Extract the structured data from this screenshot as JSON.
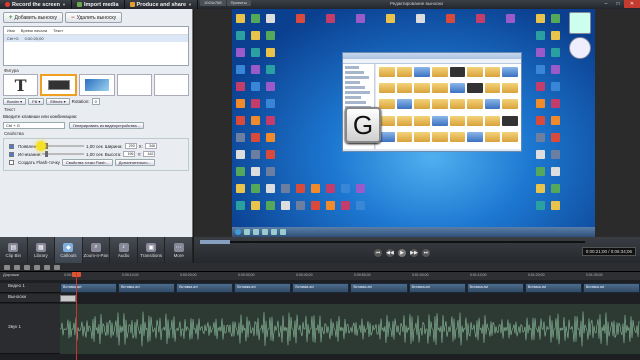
{
  "topbar": {
    "record_label": "Record the screen",
    "import_label": "Import media",
    "produce_label": "Produce and share",
    "canvas_tabs": [
      "1024x768",
      "Проекты"
    ],
    "window_title": "Редактирование выноски",
    "win_controls": [
      "–",
      "□",
      "✕"
    ]
  },
  "left_panel": {
    "add_label": "Добавить выноску",
    "remove_label": "Удалить выноску",
    "list_headers": [
      "Имя",
      "Время начала",
      "Текст"
    ],
    "list_row": [
      "Ctrl+G",
      "0:00:20;00",
      ""
    ],
    "shape_section": "Фигура",
    "border_label": "Border",
    "fill_label": "Fill",
    "effects_label": "Effects",
    "rotation_label": "Rotation:",
    "rotation_value": "0",
    "text_section": "Текст",
    "hotkey_prompt": "Введите клавиши или комбинацию:",
    "hotkey_value": "Ctrl + G",
    "generate_label": "Генерировать из видеоустройства...",
    "props_section": "Свойства",
    "fade_in_label": "Появление:",
    "fade_out_label": "Исчезание:",
    "fade_in_time": "1,00 сек",
    "fade_out_time": "1,00 сек",
    "width_label": "Ширина:",
    "height_label": "Высота:",
    "width_value": "293",
    "height_value": "196",
    "x_label": "X:",
    "y_label": "Y:",
    "x_value": "346",
    "y_value": "442",
    "flash_label": "Создать Flash-точку",
    "flash_points_label": "Свойства точки Flash...",
    "help_label": "Дополнительно..."
  },
  "tools": [
    {
      "label": "Clip Bin",
      "icon": "clip-bin-icon"
    },
    {
      "label": "Library",
      "icon": "library-icon"
    },
    {
      "label": "Callouts",
      "icon": "callouts-icon"
    },
    {
      "label": "Zoom-n-Pan",
      "icon": "zoom-icon"
    },
    {
      "label": "Audio",
      "icon": "audio-icon"
    },
    {
      "label": "Transitions",
      "icon": "transitions-icon"
    },
    {
      "label": "More",
      "icon": "more-icon"
    }
  ],
  "preview": {
    "key_letter": "G",
    "time_display": "0:00:21;00 / 0:06:34;06"
  },
  "timeline": {
    "tracks_label": "Дорожки",
    "ruler_ticks": [
      "0:00:00;00",
      "0:00:10;00",
      "0:00:20;00",
      "0:00:30;00",
      "0:00:40;00",
      "0:00:50;00",
      "0:01:00;00",
      "0:01:10;00",
      "0:01:20;00",
      "0:01:30;00"
    ],
    "video_track": "Видео 1",
    "callout_track": "Выноски",
    "audio_track": "Звук 1",
    "clip_label": "Вставка.avi"
  },
  "colors": {
    "accent": "#f0a020",
    "cursor_highlight": "#f5e12a",
    "playhead": "#cc3333"
  }
}
